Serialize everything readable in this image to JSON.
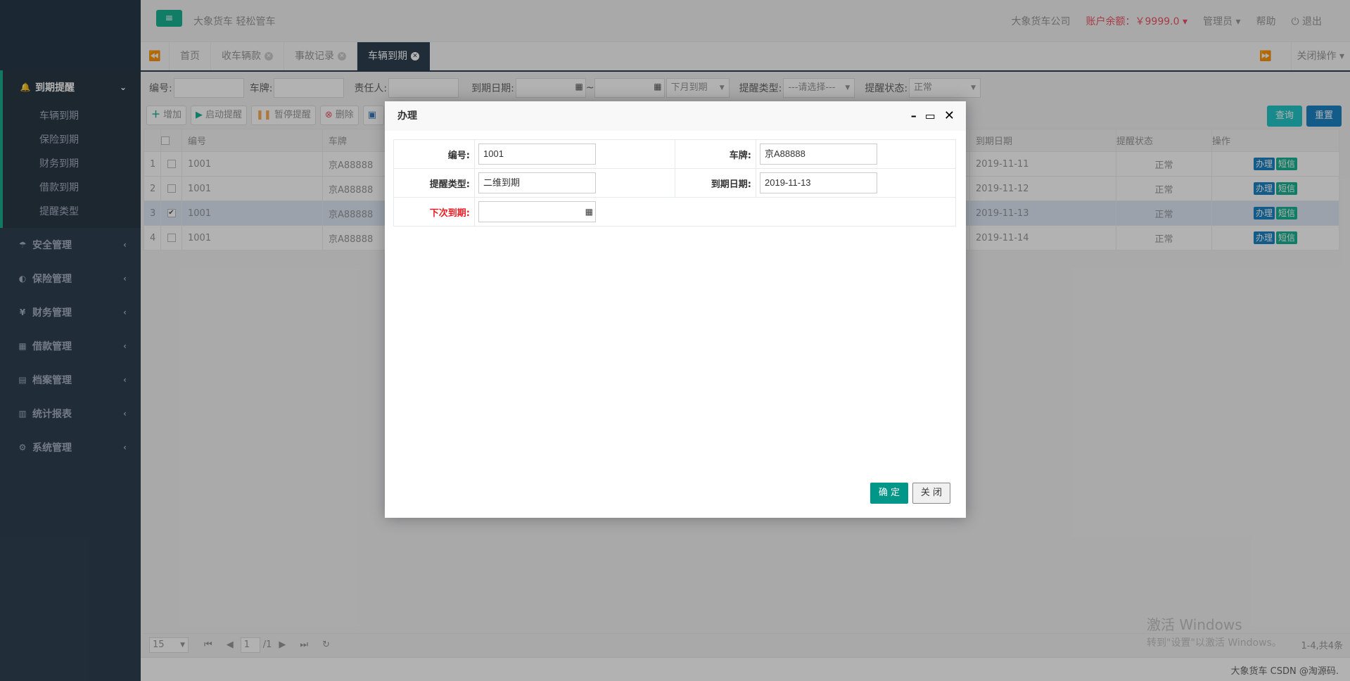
{
  "header": {
    "toggle_icon": "≡",
    "slogan": "大象货车 轻松管车",
    "company": "大象货车公司",
    "balance": "账户余额：￥9999.0",
    "admin": "管理员",
    "help": "帮助",
    "logout": "退出"
  },
  "sidebar": {
    "active_group": {
      "label": "到期提醒",
      "icon": "bell-icon"
    },
    "sub_items": [
      "车辆到期",
      "保险到期",
      "财务到期",
      "借款到期",
      "提醒类型"
    ],
    "groups": [
      {
        "label": "安全管理",
        "icon": "umbrella-icon",
        "glyph": "☂"
      },
      {
        "label": "保险管理",
        "icon": "shield-icon",
        "glyph": "◐"
      },
      {
        "label": "财务管理",
        "icon": "yen-icon",
        "glyph": "¥"
      },
      {
        "label": "借款管理",
        "icon": "calculator-icon",
        "glyph": "▦"
      },
      {
        "label": "档案管理",
        "icon": "file-icon",
        "glyph": "▤"
      },
      {
        "label": "统计报表",
        "icon": "bar-chart-icon",
        "glyph": "▥"
      },
      {
        "label": "系统管理",
        "icon": "gear-icon",
        "glyph": "⚙"
      }
    ]
  },
  "tabs": {
    "items": [
      {
        "label": "首页",
        "closable": false
      },
      {
        "label": "收车辆款",
        "closable": true
      },
      {
        "label": "事故记录",
        "closable": true
      },
      {
        "label": "车辆到期",
        "closable": true,
        "active": true
      }
    ],
    "close_ops": "关闭操作"
  },
  "search": {
    "id_label": "编号:",
    "plate_label": "车牌:",
    "owner_label": "责任人:",
    "date_label": "到期日期:",
    "range_sep": "~",
    "period_value": "下月到期",
    "type_label": "提醒类型:",
    "type_value": "---请选择---",
    "status_label": "提醒状态:",
    "status_value": "正常",
    "query": "查询",
    "reset": "重置"
  },
  "toolbar": {
    "add": "增加",
    "start": "启动提醒",
    "pause": "暂停提醒",
    "delete": "删除"
  },
  "table": {
    "headers": {
      "id": "编号",
      "plate": "车牌",
      "due": "到期日期",
      "status": "提醒状态",
      "ops": "操作"
    },
    "rows": [
      {
        "num": "1",
        "id": "1001",
        "plate": "京A88888",
        "due": "2019-11-11",
        "status": "正常",
        "checked": false
      },
      {
        "num": "2",
        "id": "1001",
        "plate": "京A88888",
        "due": "2019-11-12",
        "status": "正常",
        "checked": false
      },
      {
        "num": "3",
        "id": "1001",
        "plate": "京A88888",
        "due": "2019-11-13",
        "status": "正常",
        "checked": true
      },
      {
        "num": "4",
        "id": "1001",
        "plate": "京A88888",
        "due": "2019-11-14",
        "status": "正常",
        "checked": false
      }
    ],
    "op_handle": "办理",
    "op_sms": "短信"
  },
  "pager": {
    "page_size": "15",
    "page": "1",
    "total_pages": "/1",
    "info": "1-4,共4条"
  },
  "footer": {
    "text": "大象货车 CSDN @淘源码."
  },
  "watermark": {
    "line1": "激活 Windows",
    "line2": "转到\"设置\"以激活 Windows。"
  },
  "dialog": {
    "title": "办理",
    "id_label": "编号:",
    "id_value": "1001",
    "plate_label": "车牌:",
    "plate_value": "京A88888",
    "type_label": "提醒类型:",
    "type_value": "二维到期",
    "due_label": "到期日期:",
    "due_value": "2019-11-13",
    "next_label": "下次到期:",
    "next_value": "",
    "ok": "确 定",
    "close": "关 闭"
  },
  "colors": {
    "accent": "#1ab394",
    "sidebar": "#2f4050",
    "danger": "#ed5565",
    "ok_button": "#009688"
  }
}
